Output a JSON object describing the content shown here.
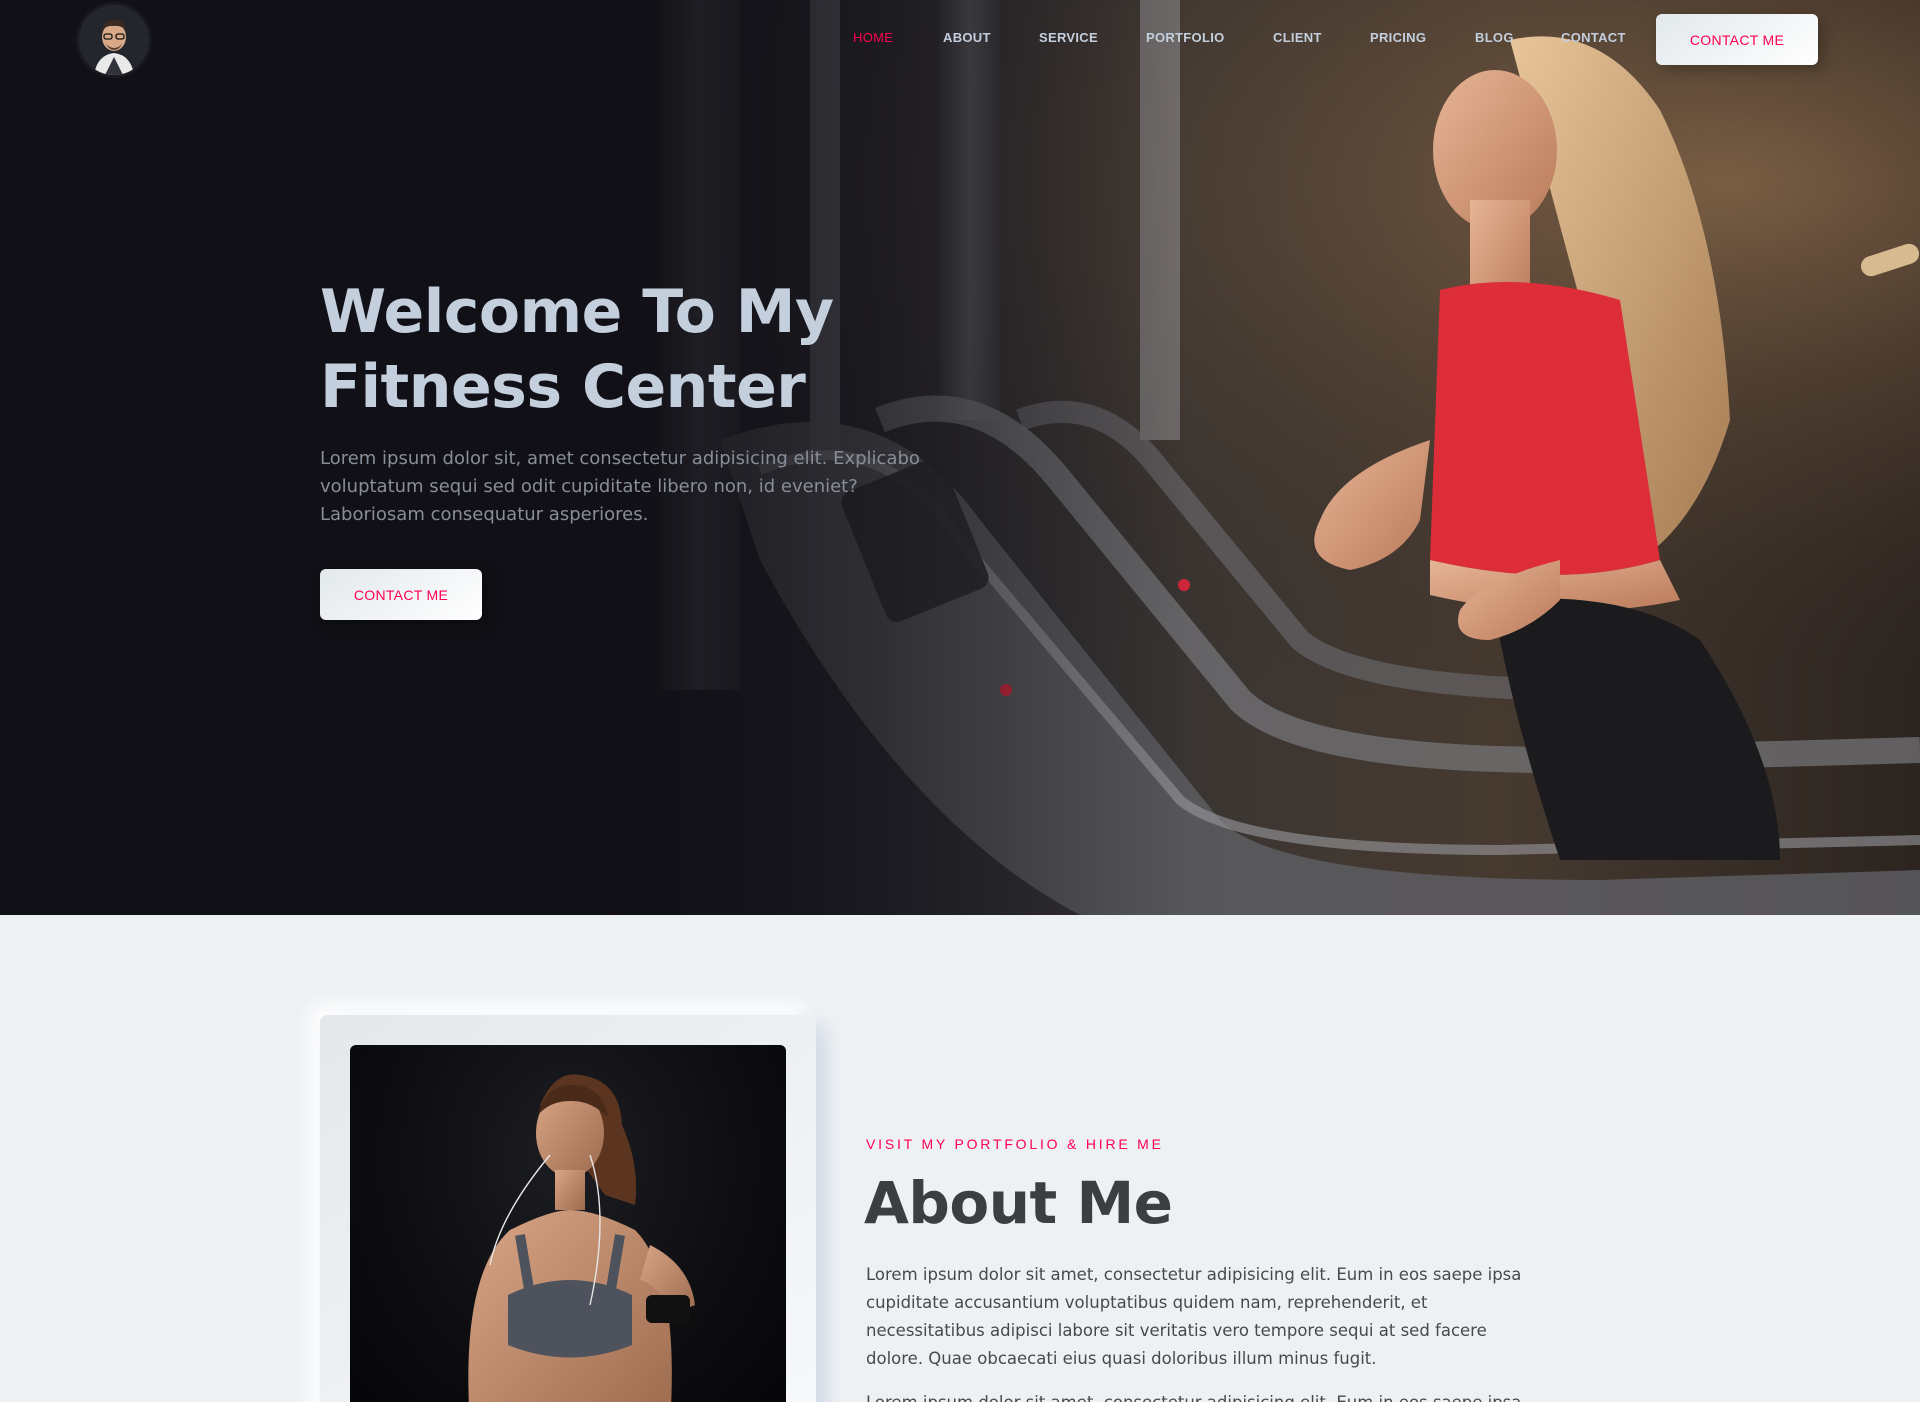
{
  "nav": {
    "items": [
      {
        "label": "HOME",
        "active": true
      },
      {
        "label": "ABOUT",
        "active": false
      },
      {
        "label": "SERVICE",
        "active": false
      },
      {
        "label": "PORTFOLIO",
        "active": false
      },
      {
        "label": "CLIENT",
        "active": false
      },
      {
        "label": "PRICING",
        "active": false
      },
      {
        "label": "BLOG",
        "active": false
      },
      {
        "label": "CONTACT",
        "active": false
      }
    ],
    "cta_label": "CONTACT ME"
  },
  "hero": {
    "title_line1": "Welcome To My",
    "title_line2": "Fitness Center",
    "text": "Lorem ipsum dolor sit, amet consectetur adipisicing elit. Explicabo voluptatum sequi sed odit cupiditate libero non, id eveniet? Laboriosam consequatur asperiores.",
    "cta_label": "CONTACT ME"
  },
  "about": {
    "subtitle": "VISIT MY PORTFOLIO & HIRE ME",
    "title": "About Me",
    "text": "Lorem ipsum dolor sit amet, consectetur adipisicing elit. Eum in eos saepe ipsa cupiditate accusantium voluptatibus quidem nam, reprehenderit, et necessitatibus adipisci labore sit veritatis vero tempore sequi at sed facere dolore. Quae obcaecati eius quasi doloribus illum minus fugit.",
    "text2": "Lorem ipsum dolor sit amet, consectetur adipisicing elit. Eum in eos saepe ipsa"
  },
  "colors": {
    "accent": "#ff014f",
    "hero_text": "#c4cfde",
    "hero_body": "#878e99",
    "about_bg": "#eef1f4",
    "dark_bg": "#121118"
  },
  "icons": {
    "logo": "avatar-icon"
  }
}
